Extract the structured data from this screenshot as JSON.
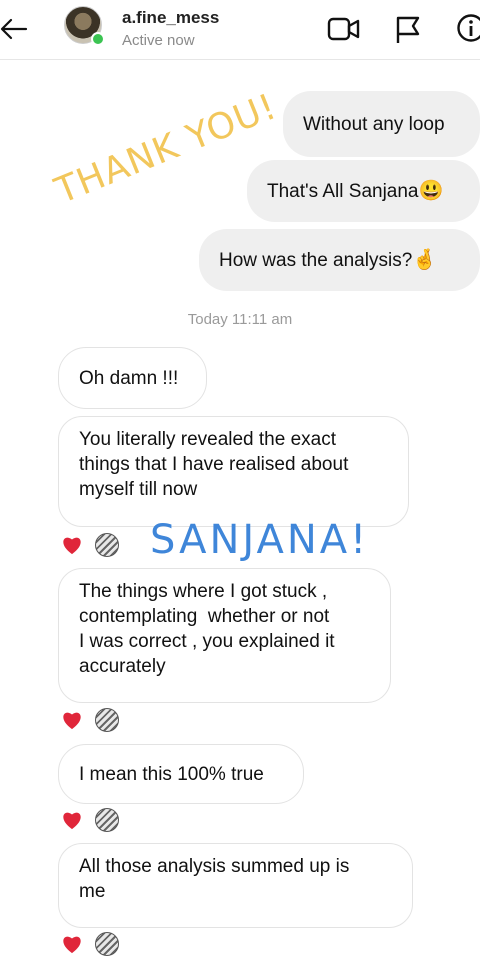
{
  "header": {
    "username": "a.fine_mess",
    "status": "Active now"
  },
  "messages_out": [
    {
      "text": "Without any loop"
    },
    {
      "text": "That's All Sanjana",
      "emoji": "😃"
    },
    {
      "text": "How was the analysis?",
      "emoji": "🤞"
    }
  ],
  "timestamp": "Today 11:11 am",
  "messages_in": [
    {
      "lines": [
        "Oh damn !!!"
      ]
    },
    {
      "lines": [
        "You literally revealed the exact",
        "things that I have realised about",
        "myself till now"
      ]
    },
    {
      "lines": [
        "The things where I got stuck ,",
        "contemplating  whether or not",
        "I was correct , you explained it",
        "accurately"
      ]
    },
    {
      "lines": [
        "I mean this 100% true"
      ]
    },
    {
      "lines": [
        "All those analysis summed up is",
        "me"
      ]
    }
  ],
  "stickers": {
    "thanks": "THANK YOU!",
    "sanjana": "SANJANA!"
  },
  "colors": {
    "online": "#3bc452",
    "heart": "#e0263a",
    "sticker_yellow": "#f2c75c",
    "sticker_blue": "#3f86d9",
    "outgoing_bubble": "#efefef"
  }
}
